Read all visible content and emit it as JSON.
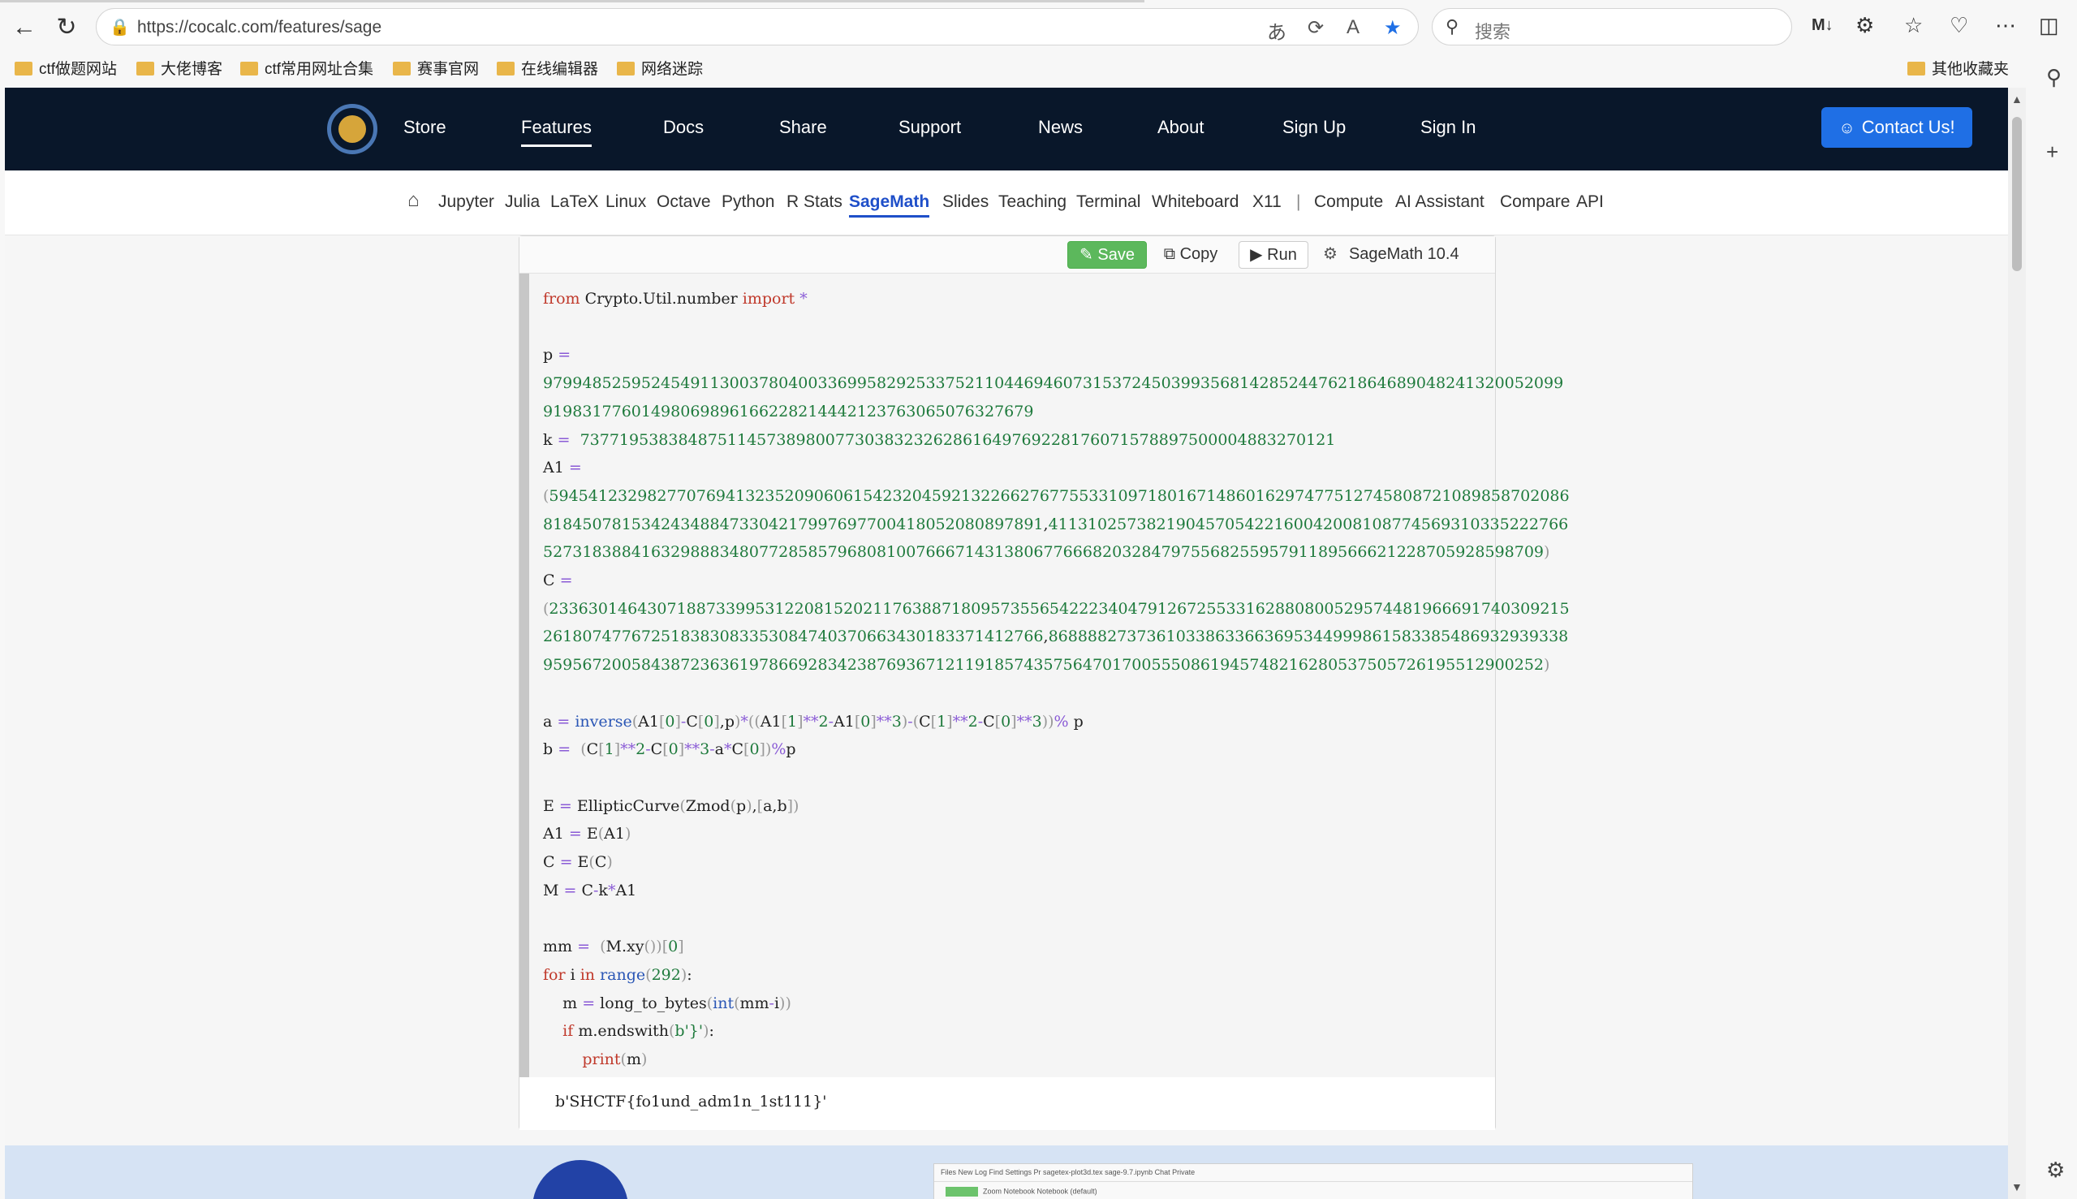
{
  "browser": {
    "url": "https://cocalc.com/features/sage",
    "search_placeholder": "搜索",
    "bookmarks": [
      "ctf做题网站",
      "大佬博客",
      "ctf常用网址合集",
      "赛事官网",
      "在线编辑器",
      "网络迷踪"
    ],
    "other_bookmarks": "其他收藏夹"
  },
  "topnav": {
    "links": [
      "Store",
      "Features",
      "Docs",
      "Share",
      "Support",
      "News",
      "About",
      "Sign Up",
      "Sign In"
    ],
    "active": "Features",
    "contact_label": "Contact Us!"
  },
  "subnav": {
    "links": [
      "Jupyter",
      "Julia",
      "LaTeX",
      "Linux",
      "Octave",
      "Python",
      "R Stats",
      "SageMath",
      "Slides",
      "Teaching",
      "Terminal",
      "Whiteboard",
      "X11",
      "|",
      "Compute",
      "AI Assistant",
      "Compare",
      "API"
    ],
    "active": "SageMath"
  },
  "cell": {
    "save_label": "Save",
    "copy_label": "Copy",
    "run_label": "Run",
    "kernel_label": "SageMath 10.4",
    "output": "b'SHCTF{fo1und_adm1n_1st111}'"
  },
  "bottom_preview": {
    "row1": "Files  New  Log  Find  Settings  Pr   sagetex-plot3d.tex   sage-9.7.ipynb                                                   Chat  Private",
    "row2": "Zoom   Notebook   Notebook (default)"
  }
}
